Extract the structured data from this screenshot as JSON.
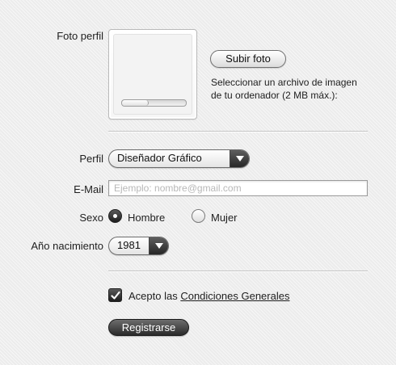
{
  "photo": {
    "label": "Foto perfil",
    "upload_button": "Subir foto",
    "hint_line1": "Seleccionar un archivo de imagen",
    "hint_line2": "de tu ordenador (2 MB máx.):",
    "upload_progress": 0.4
  },
  "perfil": {
    "label": "Perfil",
    "selected": "Diseñador Gráfico"
  },
  "email": {
    "label": "E-Mail",
    "value": "",
    "placeholder": "Ejemplo: nombre@gmail.com"
  },
  "sexo": {
    "label": "Sexo",
    "options": [
      {
        "label": "Hombre",
        "checked": true
      },
      {
        "label": "Mujer",
        "checked": false
      }
    ]
  },
  "nacimiento": {
    "label": "Año nacimiento",
    "selected": "1981"
  },
  "terms": {
    "checked": true,
    "prefix": "Acepto las",
    "link": "Condiciones Generales"
  },
  "submit": {
    "label": "Registrarse"
  },
  "icons": {
    "select_arrow": "chevron-down-icon",
    "checkbox_mark": "check-icon"
  }
}
